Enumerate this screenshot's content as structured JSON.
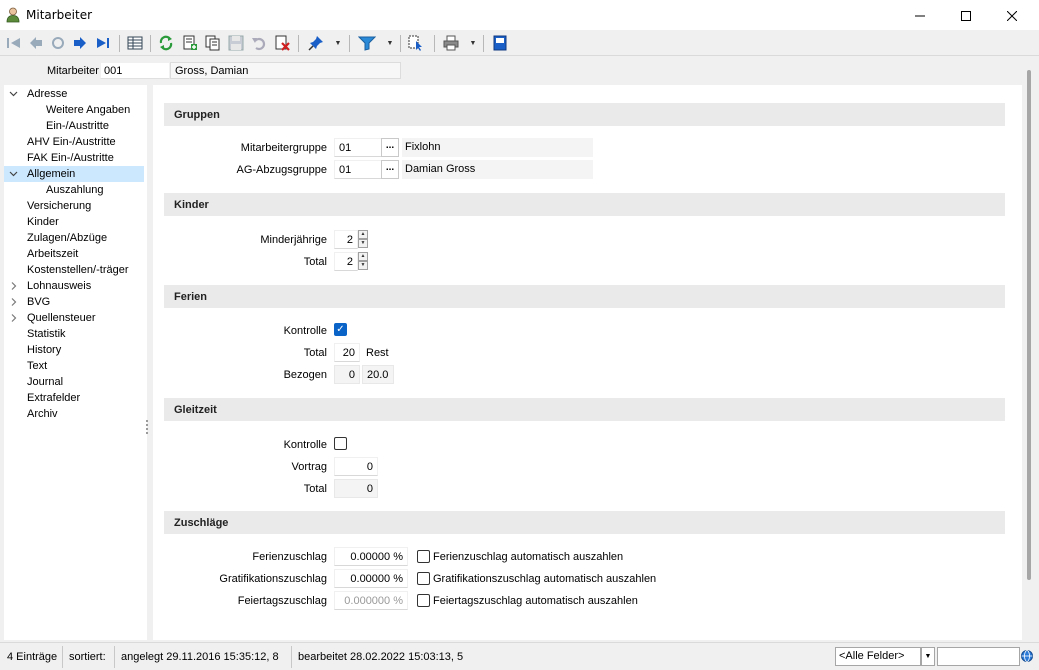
{
  "window": {
    "title": "Mitarbeiter"
  },
  "header": {
    "label": "Mitarbeiter",
    "id": "001",
    "name": "Gross, Damian"
  },
  "tree": [
    {
      "label": "Adresse",
      "indent": 0,
      "expander": "open"
    },
    {
      "label": "Weitere Angaben",
      "indent": 1
    },
    {
      "label": "Ein-/Austritte",
      "indent": 1
    },
    {
      "label": "AHV Ein-/Austritte",
      "indent": 0
    },
    {
      "label": "FAK Ein-/Austritte",
      "indent": 0
    },
    {
      "label": "Allgemein",
      "indent": 0,
      "expander": "open",
      "selected": true
    },
    {
      "label": "Auszahlung",
      "indent": 1
    },
    {
      "label": "Versicherung",
      "indent": 0
    },
    {
      "label": "Kinder",
      "indent": 0
    },
    {
      "label": "Zulagen/Abzüge",
      "indent": 0
    },
    {
      "label": "Arbeitszeit",
      "indent": 0
    },
    {
      "label": "Kostenstellen/-träger",
      "indent": 0
    },
    {
      "label": "Lohnausweis",
      "indent": 0,
      "expander": "closed"
    },
    {
      "label": "BVG",
      "indent": 0,
      "expander": "closed"
    },
    {
      "label": "Quellensteuer",
      "indent": 0,
      "expander": "closed"
    },
    {
      "label": "Statistik",
      "indent": 0
    },
    {
      "label": "History",
      "indent": 0
    },
    {
      "label": "Text",
      "indent": 0
    },
    {
      "label": "Journal",
      "indent": 0
    },
    {
      "label": "Extrafelder",
      "indent": 0
    },
    {
      "label": "Archiv",
      "indent": 0
    }
  ],
  "gruppen": {
    "title": "Gruppen",
    "mitarbeitergruppe": {
      "label": "Mitarbeitergruppe",
      "value": "01",
      "desc": "Fixlohn"
    },
    "agabzugsgruppe": {
      "label": "AG-Abzugsgruppe",
      "value": "01",
      "desc": "Damian Gross"
    },
    "dots": "..."
  },
  "kinder": {
    "title": "Kinder",
    "minderjaehrige": {
      "label": "Minderjährige",
      "value": "2"
    },
    "total": {
      "label": "Total",
      "value": "2"
    }
  },
  "ferien": {
    "title": "Ferien",
    "kontrolle": {
      "label": "Kontrolle",
      "checked": true
    },
    "total": {
      "label": "Total",
      "value": "20",
      "suffix": "Rest"
    },
    "bezogen": {
      "label": "Bezogen",
      "value": "0",
      "rest": "20.0"
    }
  },
  "gleitzeit": {
    "title": "Gleitzeit",
    "kontrolle": {
      "label": "Kontrolle",
      "checked": false
    },
    "vortrag": {
      "label": "Vortrag",
      "value": "0"
    },
    "total": {
      "label": "Total",
      "value": "0"
    }
  },
  "zuschlaege": {
    "title": "Zuschläge",
    "ferien": {
      "label": "Ferienzuschlag",
      "value": "0.00000 %",
      "auto": "Ferienzuschlag automatisch auszahlen"
    },
    "grat": {
      "label": "Gratifikationszuschlag",
      "value": "0.00000 %",
      "auto": "Gratifikationszuschlag automatisch auszahlen"
    },
    "feiertag": {
      "label": "Feiertagszuschlag",
      "value": "0.000000 %",
      "auto": "Feiertagszuschlag automatisch auszahlen"
    }
  },
  "status": {
    "entries": "4 Einträge",
    "sorted": "sortiert:",
    "created": "angelegt 29.11.2016 15:35:12,  8",
    "edited": "bearbeitet 28.02.2022 15:03:13,  5",
    "field_combo": "<Alle Felder>"
  },
  "colors": {
    "selection": "#cce8ff",
    "accent": "#0a64c8"
  }
}
